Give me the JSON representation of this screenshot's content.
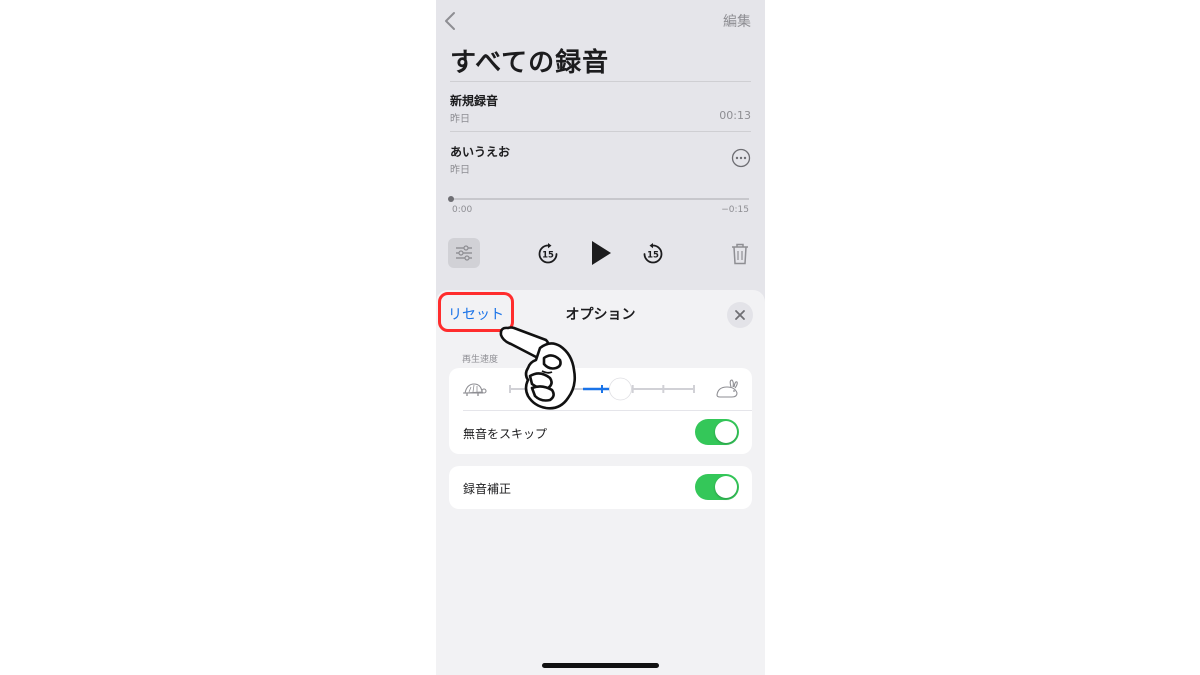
{
  "topbar": {
    "back_icon": "chevron-left-icon",
    "edit_label": "編集"
  },
  "page_title": "すべての録音",
  "recordings": [
    {
      "title": "新規録音",
      "date": "昨日",
      "duration": "00:13"
    },
    {
      "title": "あいうえお",
      "date": "昨日",
      "more_icon": "ellipsis-circle-icon"
    }
  ],
  "player": {
    "time_start": "0:00",
    "time_end": "−0:15",
    "progress": 0.0,
    "options_icon": "sliders-icon",
    "skip_back_label": "15",
    "skip_forward_label": "15",
    "play_icon": "play-icon",
    "delete_icon": "trash-icon"
  },
  "sheet": {
    "reset_label": "リセット",
    "title": "オプション",
    "close_icon": "close-icon",
    "speed_section_label": "再生速度",
    "speed": {
      "slow_icon": "turtle-icon",
      "fast_icon": "rabbit-icon",
      "level": 0.6
    },
    "skip_silence_label": "無音をスキップ",
    "skip_silence_on": true,
    "enhance_label": "録音補正",
    "enhance_on": true
  },
  "annotation": {
    "highlight_color": "#ff2d2d",
    "pointer": "pointing-hand-icon"
  },
  "colors": {
    "accent": "#1a73e8",
    "toggle_on": "#34c759",
    "speed_active": "#1a73e8"
  }
}
